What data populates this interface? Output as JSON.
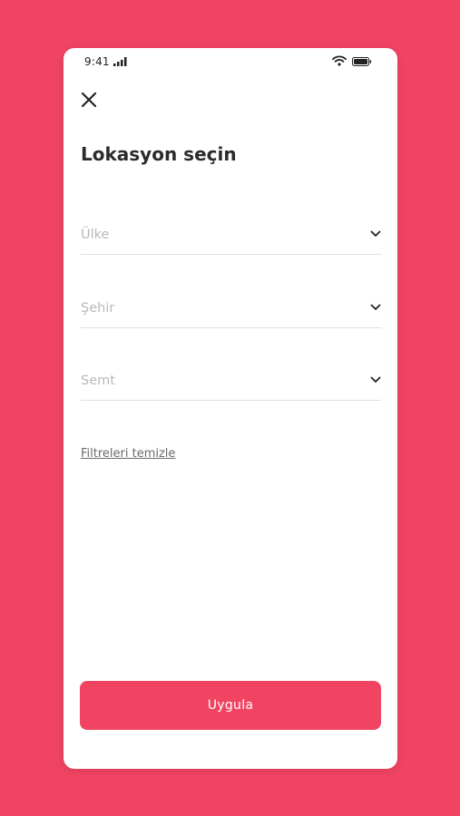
{
  "status_bar": {
    "time": "9:41",
    "icons": [
      "signal-icon",
      "wifi-icon",
      "battery-icon"
    ]
  },
  "header": {
    "close_icon": "close-icon",
    "title": "Lokasyon seçin"
  },
  "fields": {
    "country": {
      "placeholder": "Ülke",
      "icon": "chevron-down-icon"
    },
    "city": {
      "placeholder": "Şehir",
      "icon": "chevron-down-icon"
    },
    "district": {
      "placeholder": "Semt",
      "icon": "chevron-down-icon"
    }
  },
  "clear_filters_label": "Filtreleri temizle",
  "apply_label": "Uygula",
  "colors": {
    "accent": "#f14463",
    "text_primary": "#2b2b2b",
    "placeholder": "#b8b8b8",
    "divider": "#dedede"
  }
}
